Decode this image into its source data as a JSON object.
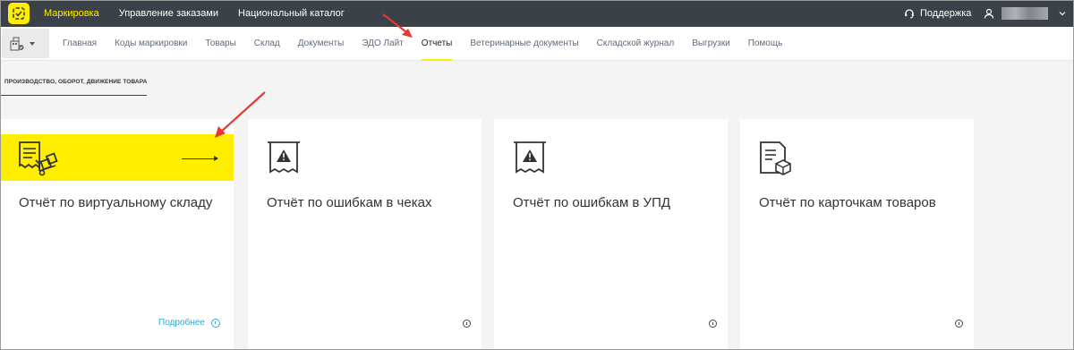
{
  "topbar": {
    "nav": [
      "Маркировка",
      "Управление заказами",
      "Национальный каталог"
    ],
    "active": 0,
    "support_label": "Поддержка"
  },
  "subnav": {
    "items": [
      "Главная",
      "Коды маркировки",
      "Товары",
      "Склад",
      "Документы",
      "ЭДО Лайт",
      "Отчеты",
      "Ветеринарные документы",
      "Складской журнал",
      "Выгрузки",
      "Помощь"
    ],
    "active_index": 6
  },
  "section_tab": "ПРОИЗВОДСТВО, ОБОРОТ, ДВИЖЕНИЕ ТОВАРА",
  "cards": [
    {
      "title": "Отчёт по виртуальному складу",
      "more_label": "Подробнее",
      "icon": "warehouse-report-icon",
      "highlighted": true
    },
    {
      "title": "Отчёт по ошибкам в чеках",
      "icon": "receipt-warning-icon"
    },
    {
      "title": "Отчёт по ошибкам в УПД",
      "icon": "receipt-warning-icon"
    },
    {
      "title": "Отчёт по карточкам товаров",
      "icon": "document-box-icon"
    }
  ],
  "colors": {
    "accent": "#ffee00",
    "topbar_bg": "#3b4148",
    "link": "#2fa6d6",
    "annotation": "#e53935"
  }
}
